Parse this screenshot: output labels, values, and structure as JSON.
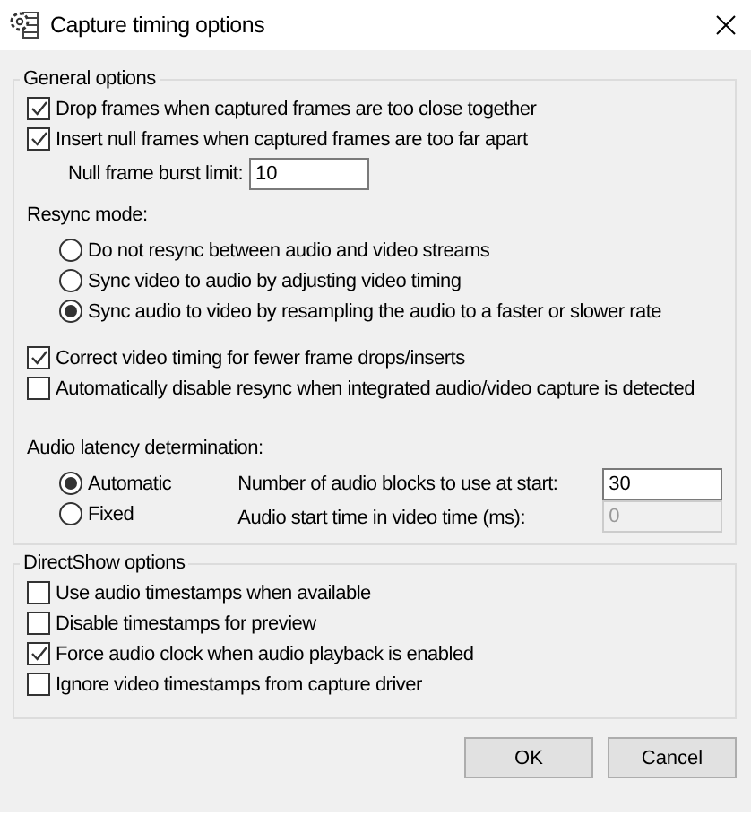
{
  "window": {
    "title": "Capture timing options"
  },
  "general_options": {
    "legend": "General options",
    "frame_checks": [
      {
        "label": "Drop frames when captured frames are too close together",
        "checked": true
      },
      {
        "label": "Insert null frames when captured frames are too far apart",
        "checked": true
      }
    ],
    "null_frame_burst_limit": {
      "label": "Null frame burst limit:",
      "value": "10"
    },
    "resync_mode": {
      "label": "Resync mode:",
      "options": [
        {
          "label": "Do not resync between audio and video streams",
          "selected": false
        },
        {
          "label": "Sync video to audio by adjusting video timing",
          "selected": false
        },
        {
          "label": "Sync audio to video by resampling the audio to a faster or slower rate",
          "selected": true
        }
      ]
    },
    "timing_checks": [
      {
        "label": "Correct video timing for fewer frame drops/inserts",
        "checked": true
      },
      {
        "label": "Automatically disable resync when integrated audio/video capture is detected",
        "checked": false
      }
    ],
    "audio_latency": {
      "label": "Audio latency determination:",
      "modes": [
        {
          "label": "Automatic",
          "selected": true
        },
        {
          "label": "Fixed",
          "selected": false
        }
      ],
      "fields": [
        {
          "label": "Number of audio blocks to use at start:",
          "value": "30",
          "disabled": false
        },
        {
          "label": "Audio start time in video time (ms):",
          "value": "0",
          "disabled": true
        }
      ]
    }
  },
  "directshow_options": {
    "legend": "DirectShow options",
    "checks": [
      {
        "label": "Use audio timestamps when available",
        "checked": false
      },
      {
        "label": "Disable timestamps for preview",
        "checked": false
      },
      {
        "label": "Force audio clock when audio playback is enabled",
        "checked": true
      },
      {
        "label": "Ignore video timestamps from capture driver",
        "checked": false
      }
    ]
  },
  "buttons": [
    {
      "label": "OK"
    },
    {
      "label": "Cancel"
    }
  ]
}
